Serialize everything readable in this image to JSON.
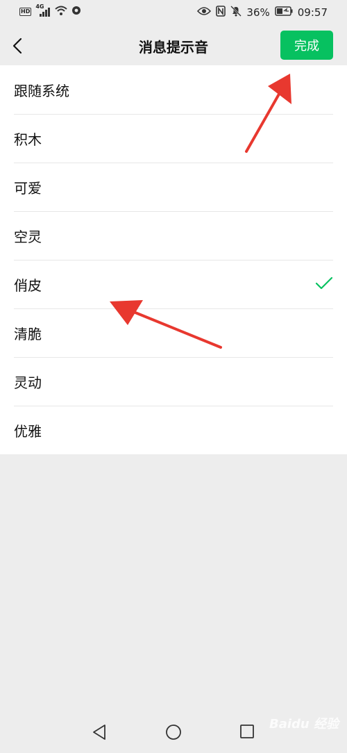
{
  "status_bar": {
    "hd": "HD",
    "network": "4G",
    "battery_percent": "36%",
    "time": "09:57"
  },
  "nav": {
    "title": "消息提示音",
    "done_label": "完成"
  },
  "list": {
    "items": [
      {
        "label": "跟随系统",
        "selected": false
      },
      {
        "label": "积木",
        "selected": false
      },
      {
        "label": "可爱",
        "selected": false
      },
      {
        "label": "空灵",
        "selected": false
      },
      {
        "label": "俏皮",
        "selected": true
      },
      {
        "label": "清脆",
        "selected": false
      },
      {
        "label": "灵动",
        "selected": false
      },
      {
        "label": "优雅",
        "selected": false
      }
    ]
  },
  "watermark": "Baidu 经验",
  "colors": {
    "accent": "#07c160",
    "annotation": "#e8382f",
    "background": "#ededed"
  }
}
